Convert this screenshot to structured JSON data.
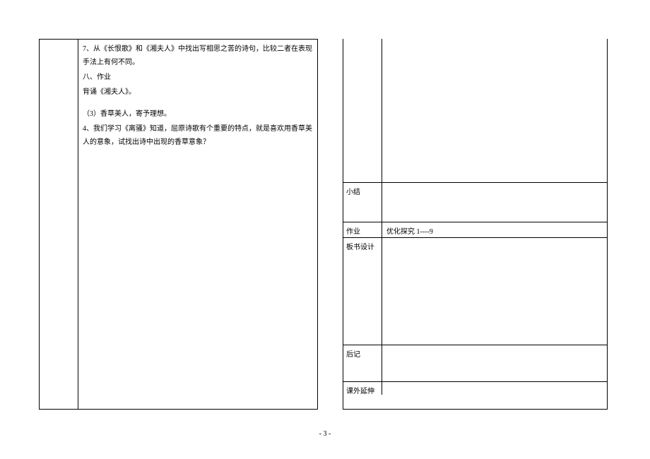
{
  "left": {
    "p1": "7、从《长恨歌》和《湘夫人》中找出写相思之苦的诗句，比较二者在表现手法上有何不同。",
    "p2": "八、作业",
    "p3": "背诵《湘夫人》。",
    "p4": "（3）香草美人，寄予理想。",
    "p5": "4、我们学习《离骚》知道，屈原诗歌有个重要的特点，就是喜欢用香草美人的意象，试找出诗中出现的香草意象？"
  },
  "right": {
    "row1_label": "",
    "row2_label": "小结",
    "row3_label": "作业",
    "row3_content": "优化探究 1----9",
    "row4_label": "板书设计",
    "row5_label": "后记",
    "row6_label": "课外延伸"
  },
  "page_number": "- 3 -"
}
